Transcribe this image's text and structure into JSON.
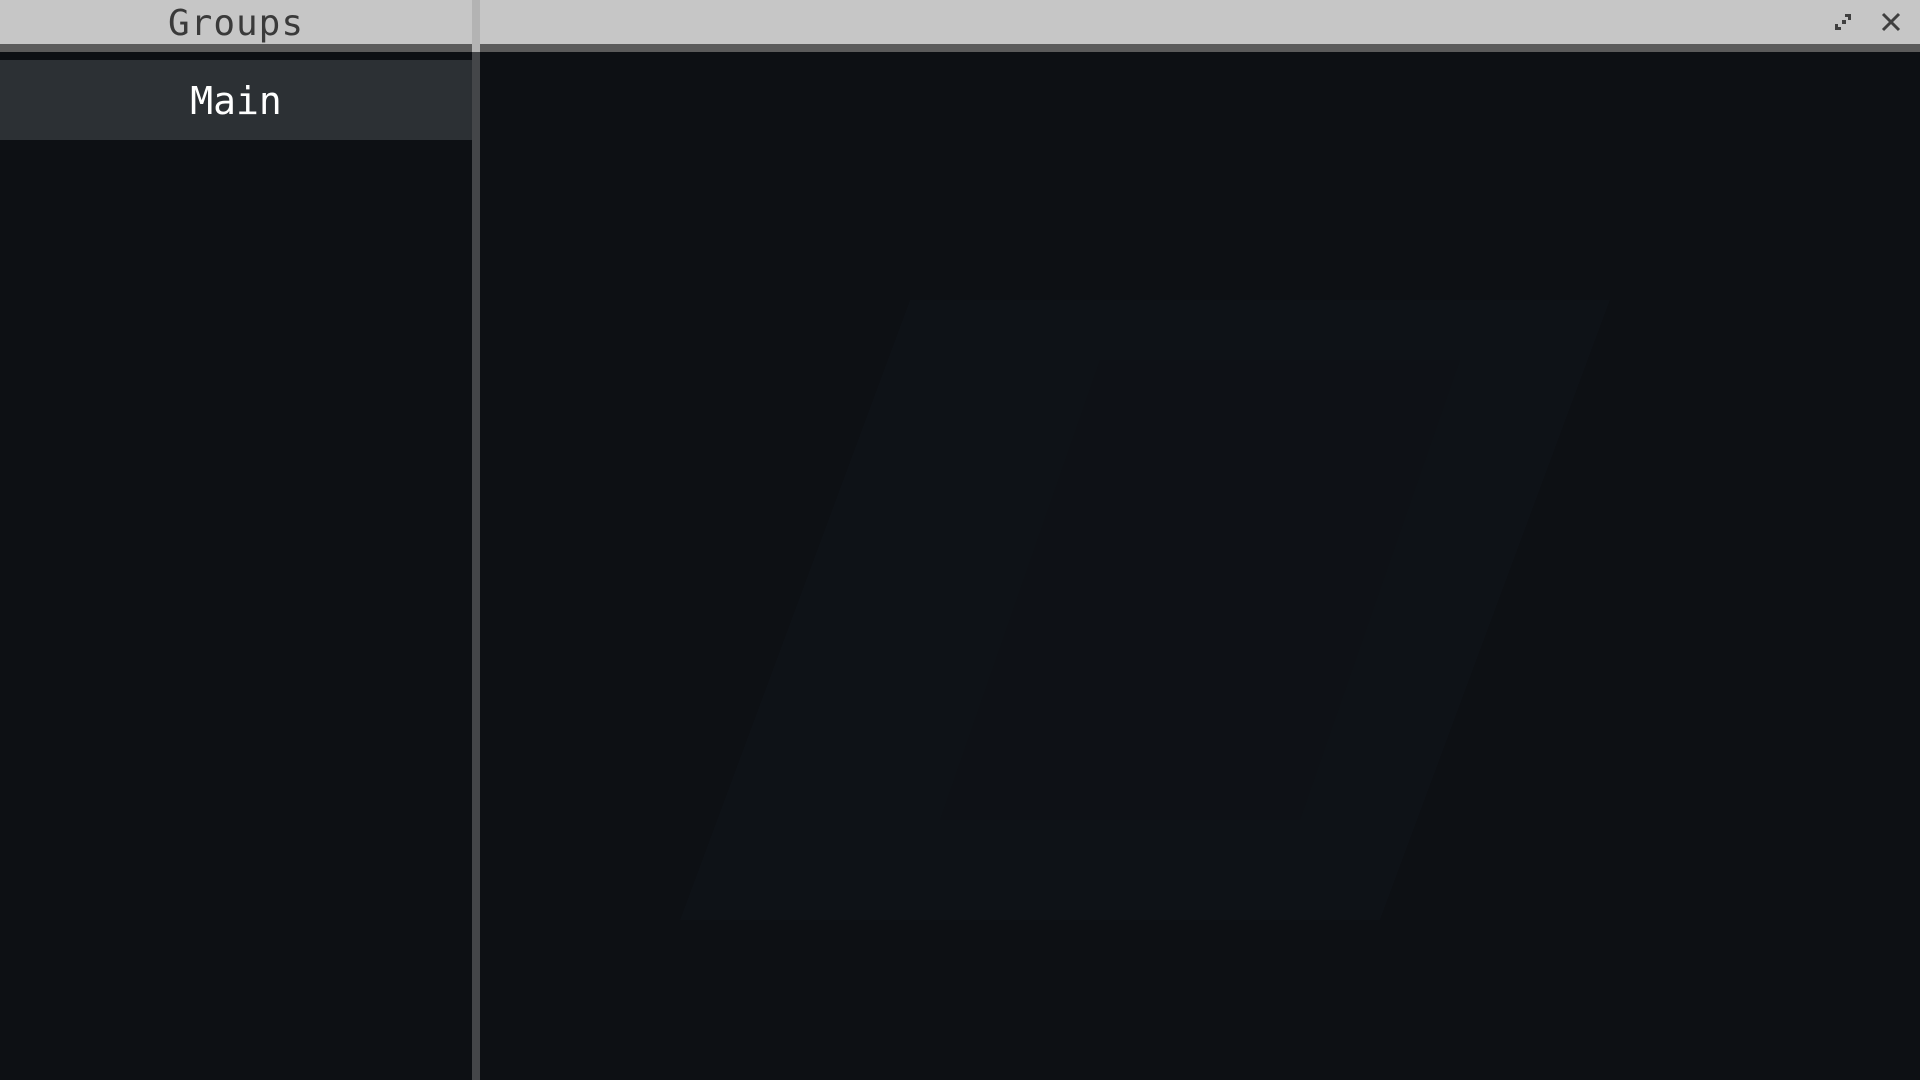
{
  "header": {
    "title": "Groups",
    "controls": [
      {
        "icon": "expand-icon"
      },
      {
        "icon": "close-icon"
      }
    ]
  },
  "sidebar": {
    "items": [
      {
        "label": "Main",
        "selected": true
      }
    ]
  },
  "colors": {
    "header_bg": "#c6c6c6",
    "header_text": "#3a3a3a",
    "divider": "#5b5b5b",
    "panel_bg": "#0d1014",
    "selected_item_bg": "#2c3034",
    "selected_item_text": "#ffffff"
  }
}
